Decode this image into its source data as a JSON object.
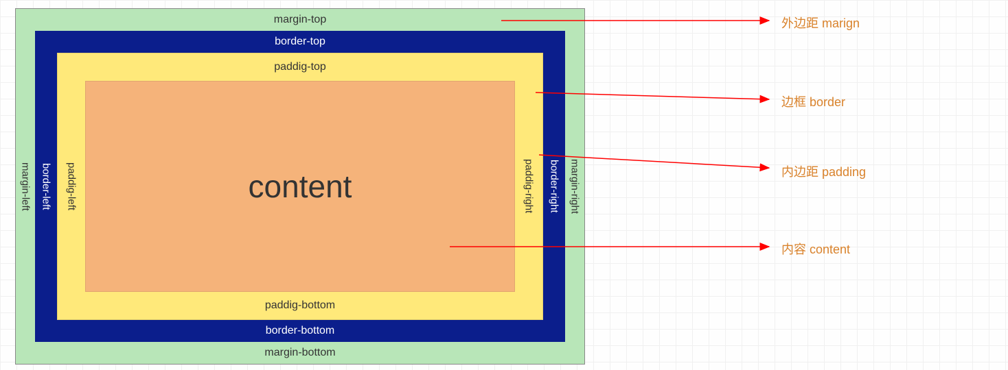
{
  "box_model": {
    "margin": {
      "top": "margin-top",
      "right": "margin-right",
      "bottom": "margin-bottom",
      "left": "margin-left"
    },
    "border": {
      "top": "border-top",
      "right": "border-right",
      "bottom": "border-bottom",
      "left": "border-left"
    },
    "padding": {
      "top": "paddig-top",
      "right": "paddig-right",
      "bottom": "paddig-bottom",
      "left": "paddig-left"
    },
    "content": "content"
  },
  "annotations": {
    "margin": "外边距 marign",
    "border": "边框 border",
    "padding": "内边距 padding",
    "content": "内容 content"
  },
  "colors": {
    "margin_bg": "#b8e6b8",
    "border_bg": "#0b1e8c",
    "padding_bg": "#ffe97a",
    "content_bg": "#f5b37a",
    "annotation_text": "#d9822b",
    "arrow": "#ff0000"
  }
}
